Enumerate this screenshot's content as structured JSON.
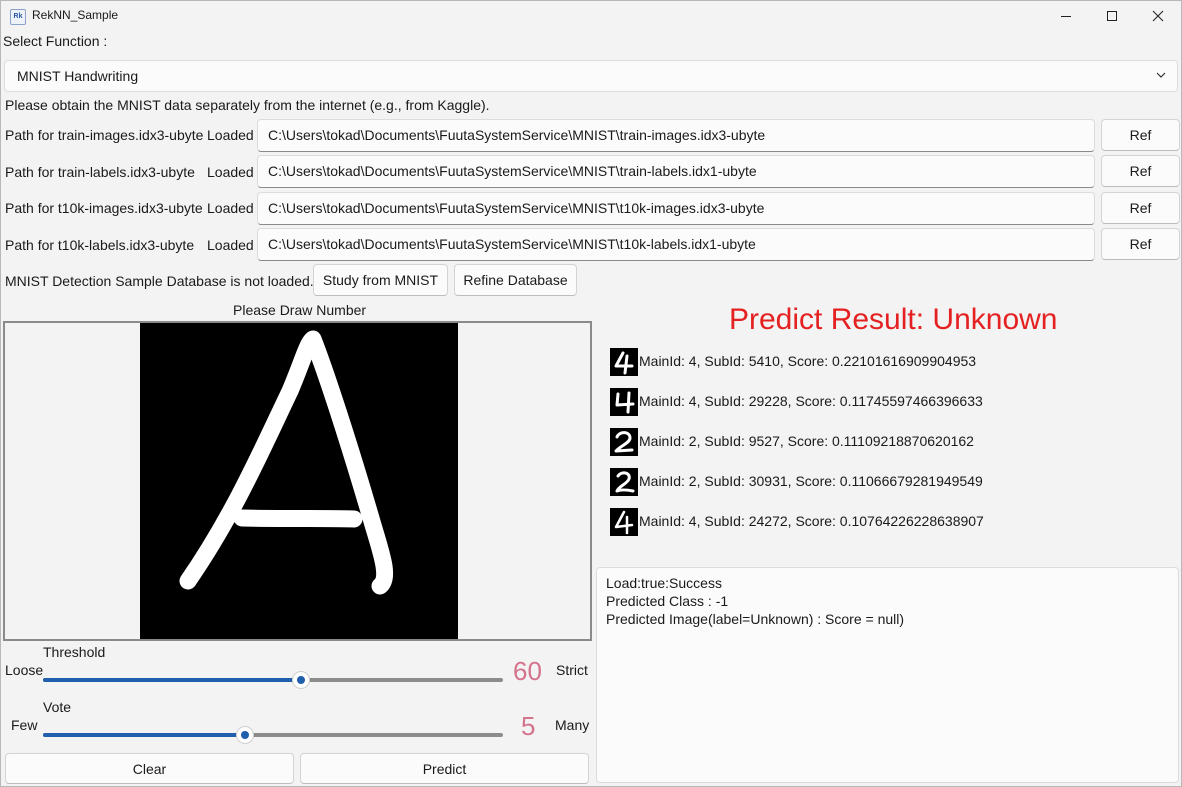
{
  "window": {
    "title": "RekNN_Sample",
    "app_icon": "app-icon"
  },
  "select_function": {
    "label": "Select Function :",
    "selected": "MNIST Handwriting"
  },
  "notice": "Please obtain the MNIST data separately from the internet (e.g., from Kaggle).",
  "paths": [
    {
      "label": "Path for train-images.idx3-ubyte",
      "status": "Loaded",
      "value": "C:\\Users\\tokad\\Documents\\FuutaSystemService\\MNIST\\train-images.idx3-ubyte",
      "button": "Ref"
    },
    {
      "label": "Path for train-labels.idx3-ubyte",
      "status": "Loaded",
      "value": "C:\\Users\\tokad\\Documents\\FuutaSystemService\\MNIST\\train-labels.idx1-ubyte",
      "button": "Ref"
    },
    {
      "label": "Path for t10k-images.idx3-ubyte",
      "status": "Loaded",
      "value": "C:\\Users\\tokad\\Documents\\FuutaSystemService\\MNIST\\t10k-images.idx3-ubyte",
      "button": "Ref"
    },
    {
      "label": "Path for t10k-labels.idx3-ubyte",
      "status": "Loaded",
      "value": "C:\\Users\\tokad\\Documents\\FuutaSystemService\\MNIST\\t10k-labels.idx1-ubyte",
      "button": "Ref"
    }
  ],
  "database": {
    "status": "MNIST Detection Sample Database is not loaded.",
    "study_button": "Study from MNIST",
    "refine_button": "Refine Database"
  },
  "canvas": {
    "title": "Please Draw Number"
  },
  "threshold": {
    "title": "Threshold",
    "min_label": "Loose",
    "max_label": "Strict",
    "value": "60",
    "level": 0.56
  },
  "vote": {
    "title": "Vote",
    "min_label": "Few",
    "max_label": "Many",
    "value": "5",
    "level": 0.44
  },
  "actions": {
    "clear": "Clear",
    "predict": "Predict"
  },
  "result": {
    "title": "Predict Result: Unknown",
    "items": [
      {
        "text": "MainId: 4, SubId: 5410, Score: 0.22101616909904953",
        "digit": "4"
      },
      {
        "text": "MainId: 4, SubId: 29228, Score: 0.11745597466396633",
        "digit": "4"
      },
      {
        "text": "MainId: 2, SubId: 9527, Score: 0.11109218870620162",
        "digit": "2"
      },
      {
        "text": "MainId: 2, SubId: 30931, Score: 0.11066679281949549",
        "digit": "2"
      },
      {
        "text": "MainId: 4, SubId: 24272, Score: 0.10764226228638907",
        "digit": "4"
      }
    ]
  },
  "log": [
    "Load:true:Success",
    "Predicted Class : -1",
    "Predicted Image(label=Unknown) : Score = null)"
  ],
  "colors": {
    "accent": "#1f5fae",
    "result_red": "#e52020",
    "value_pink": "#d4748c"
  }
}
